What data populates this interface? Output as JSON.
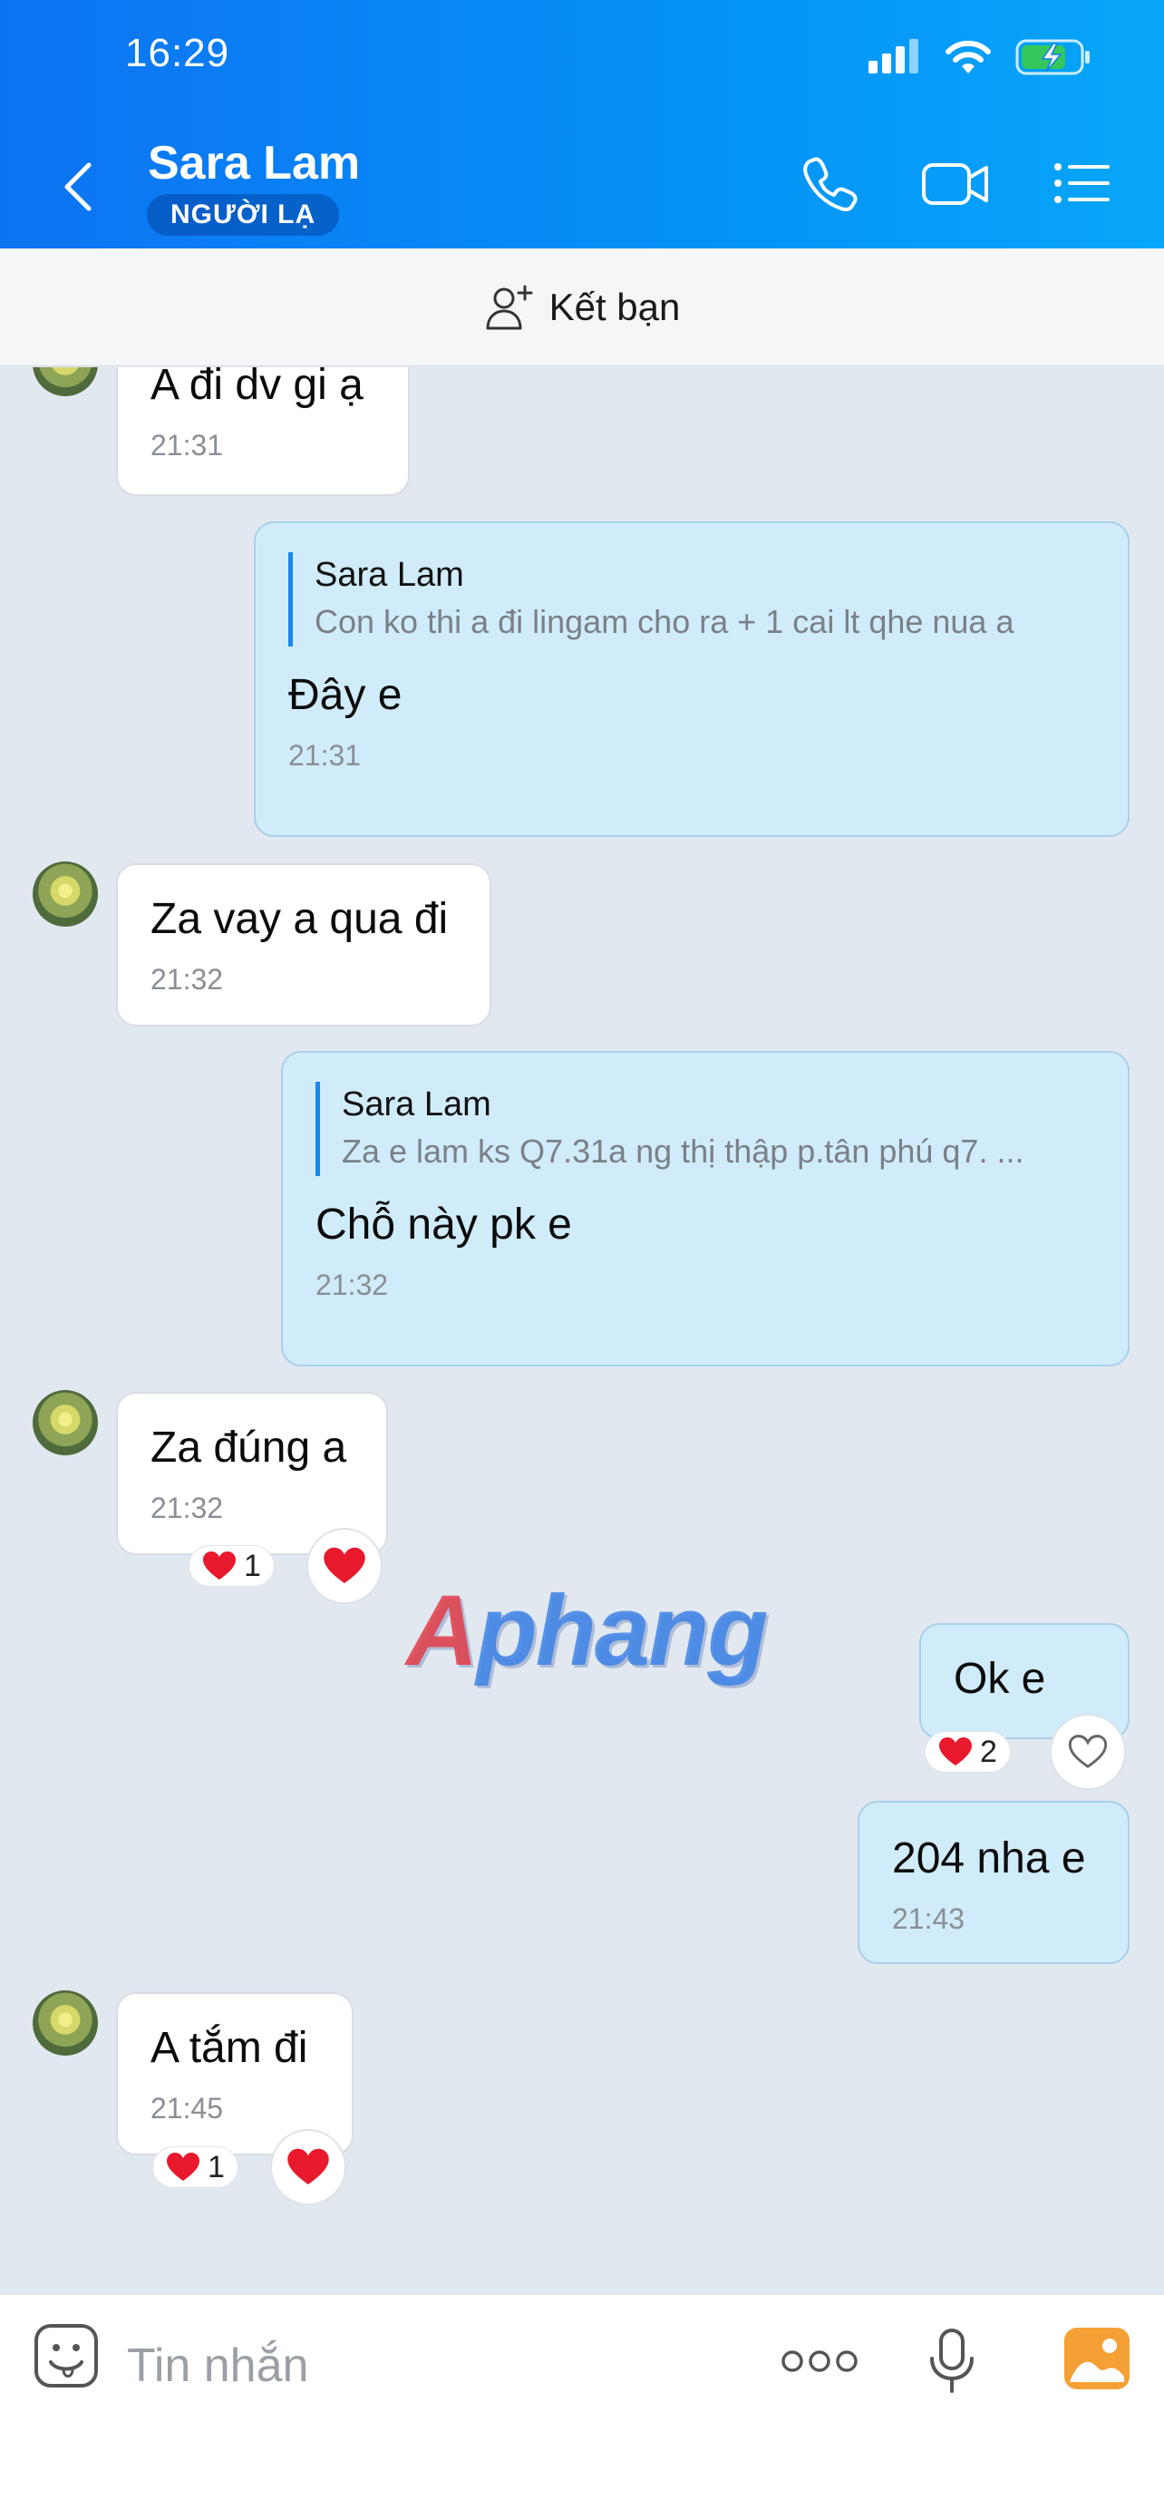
{
  "status": {
    "time": "16:29"
  },
  "header": {
    "contact_name": "Sara Lam",
    "badge": "NGƯỜI LẠ",
    "icons": [
      "back-icon",
      "phone-icon",
      "video-call-icon",
      "list-menu-icon"
    ]
  },
  "add_friend": {
    "label": "Kết bạn",
    "icon": "add-user-icon"
  },
  "messages": [
    {
      "text": "A đi dv gi ạ",
      "time": "21:31"
    },
    {
      "quote_name": "Sara Lam",
      "quote_text": "Con ko thi a đi lingam cho ra + 1 cai lt qhe nua a",
      "text": "Đây e",
      "time": "21:31"
    },
    {
      "text": "Za vay a qua đi",
      "time": "21:32"
    },
    {
      "quote_name": "Sara Lam",
      "quote_text": "Za e lam ks Q7.31a ng thị thập p.tân phú q7. ...",
      "text": "Chỗ này pk e",
      "time": "21:32"
    },
    {
      "text": "Za đúng a",
      "time": "21:32",
      "reaction_count": "1"
    },
    {
      "text": "Ok e",
      "reaction_count": "2"
    },
    {
      "text": "204 nha e",
      "time": "21:43"
    },
    {
      "text": "A tắm đi",
      "time": "21:45",
      "reaction_count": "1"
    }
  ],
  "watermark": {
    "first": "A",
    "rest": "phang"
  },
  "input": {
    "placeholder": "Tin nhắn"
  },
  "colors": {
    "header_start": "#0d73f2",
    "header_end": "#07a6f8",
    "bubble_out": "#d0ecfb",
    "bubble_in": "#ffffff",
    "reaction_heart": "#e8192c"
  }
}
